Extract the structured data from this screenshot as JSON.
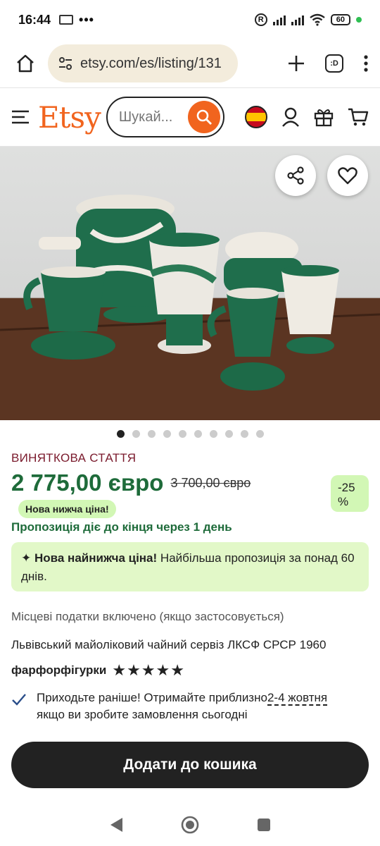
{
  "status": {
    "time": "16:44",
    "dots": "•••",
    "battery": "60"
  },
  "browser": {
    "url": "etsy.com/es/listing/131",
    "tabs_label": ":D"
  },
  "header": {
    "logo": "Etsy",
    "search_placeholder": "Шукай..."
  },
  "gallery": {
    "image_count": 10,
    "active_index": 0
  },
  "product": {
    "badge": "ВИНЯТКОВА СТАТТЯ",
    "price": "2 775,00 євро",
    "old_price": "3 700,00 євро",
    "discount": "-25 %",
    "new_price_badge": "Нова нижча ціна!",
    "offer_ends": "Пропозиція діє до кінця через 1 день",
    "promo_bold": "Нова найнижча ціна!",
    "promo_text": " Найбільша пропозиція за понад 60 днів.",
    "taxes": "Місцеві податки включено (якщо застосовується)",
    "title": "Львівський майоліковий чайний сервіз ЛКСФ СРСР 1960",
    "shop": "фарфорфігурки",
    "stars": "★★★★★",
    "delivery_prefix": "Приходьте раніше! Отримайте приблизно",
    "delivery_dates": "2-4 жовтня",
    "delivery_suffix": "якщо ви зробите замовлення сьогодні",
    "add_to_cart": "Додати до кошика"
  },
  "colors": {
    "brand": "#f1641e",
    "price_green": "#1e6b3a",
    "promo_bg": "#e2f8c8",
    "badge_bg": "#d2f7b5"
  }
}
